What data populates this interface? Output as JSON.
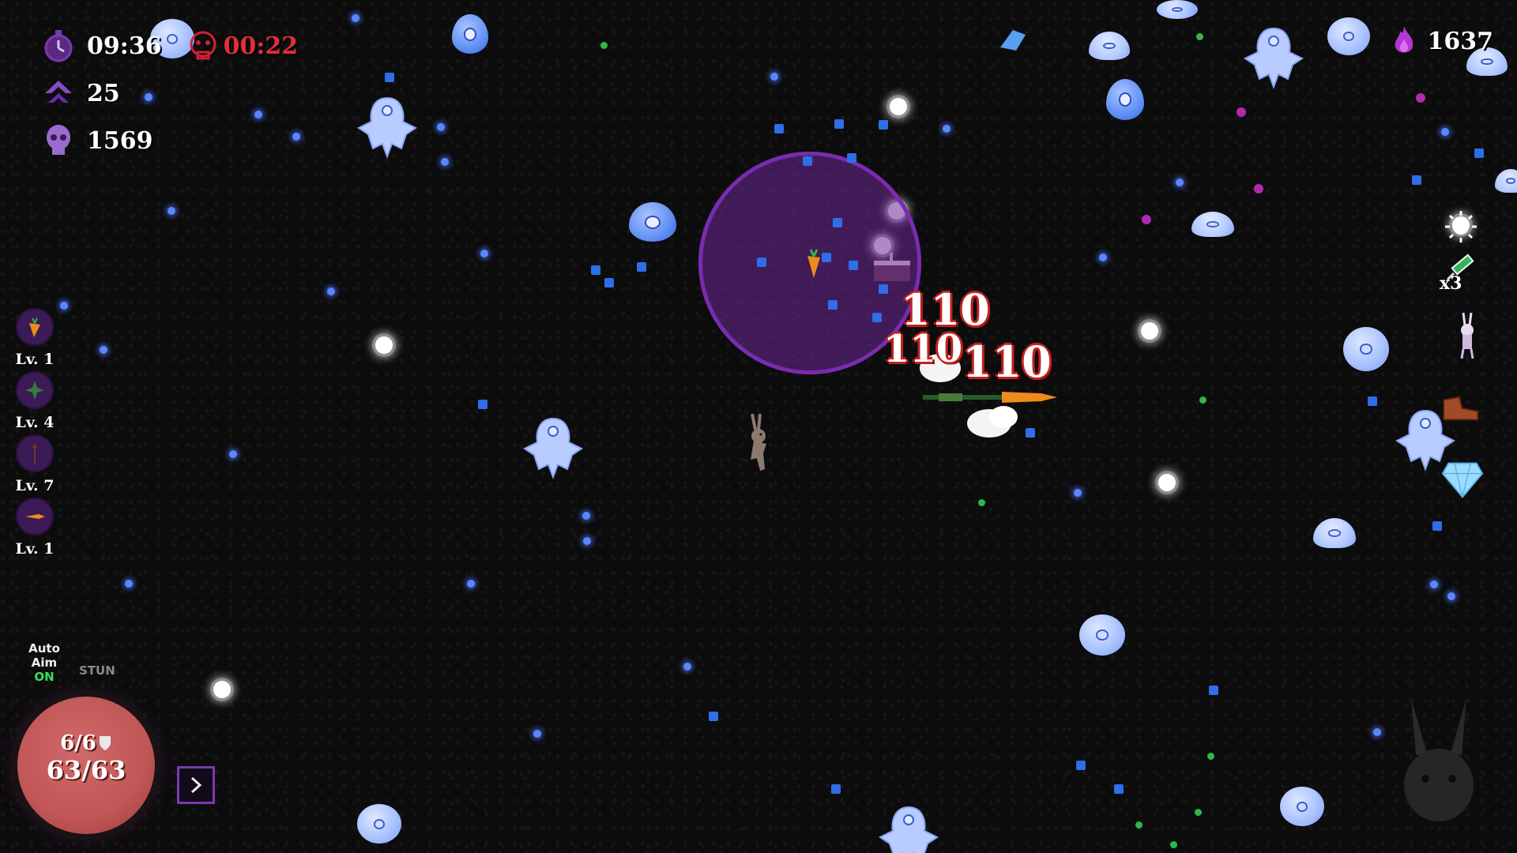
{
  "hud": {
    "timer": "09:36",
    "danger_timer": "00:22",
    "level": "25",
    "kills": "1569",
    "currency": "1637"
  },
  "weapons": [
    {
      "icon": "carrot-icon",
      "level": "Lv. 1"
    },
    {
      "icon": "leaf-cross-icon",
      "level": "Lv. 4"
    },
    {
      "icon": "spear-icon",
      "level": "Lv. 7"
    },
    {
      "icon": "carrot-bolt-icon",
      "level": "Lv. 1"
    }
  ],
  "items": [
    {
      "icon": "sun-icon"
    },
    {
      "icon": "syringe-icon",
      "count": "x3"
    },
    {
      "icon": "bunny-figure-icon"
    },
    {
      "icon": "boot-icon"
    },
    {
      "icon": "diamond-icon"
    }
  ],
  "controls": {
    "auto_aim_label_1": "Auto",
    "auto_aim_label_2": "Aim",
    "auto_aim_state": "ON",
    "stun_label": "STUN"
  },
  "health": {
    "armor": "6/6",
    "hp": "63/63"
  },
  "damage_numbers": [
    "110",
    "110",
    "110"
  ],
  "colors": {
    "aura": "#7a2bb0",
    "health_orb": "#c05656",
    "danger": "#e0303a",
    "gem_blue": "#2e6ee8",
    "gem_green": "#2fb84a"
  }
}
